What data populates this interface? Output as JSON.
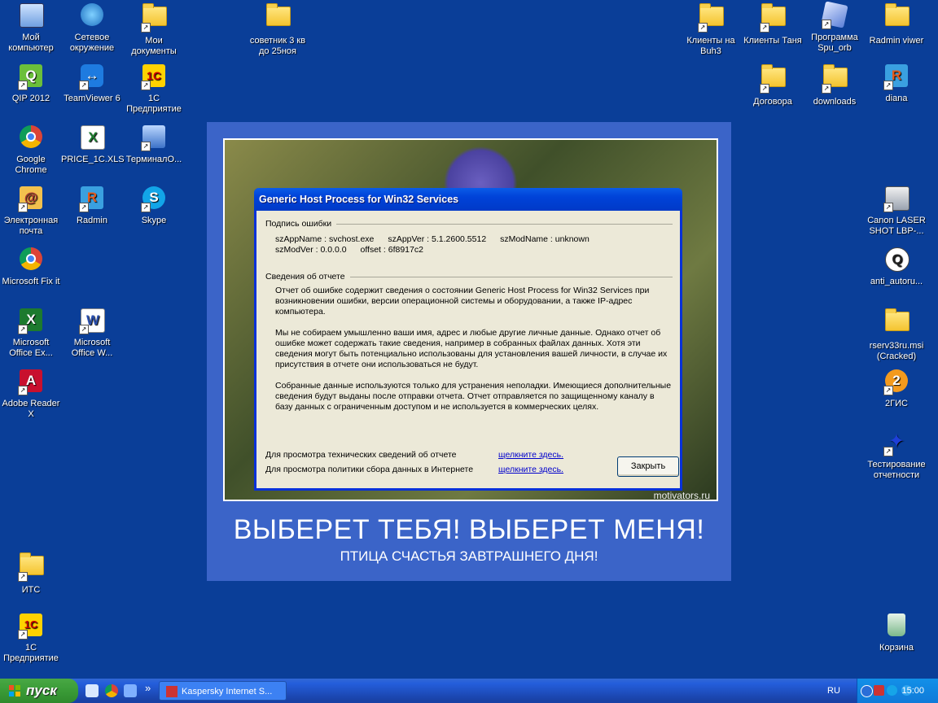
{
  "desktop_icons_left": [
    {
      "label": "Мой компьютер",
      "icon": "my-computer-icon"
    },
    {
      "label": "Сетевое окружение",
      "icon": "network-places-icon"
    },
    {
      "label": "Мои документы",
      "icon": "my-documents-icon"
    },
    {
      "label": "QIP 2012",
      "icon": "qip-icon"
    },
    {
      "label": "TeamViewer 6",
      "icon": "teamviewer-icon"
    },
    {
      "label": "1С Предприятие",
      "icon": "1c-icon"
    },
    {
      "label": "Google Chrome",
      "icon": "chrome-icon"
    },
    {
      "label": "PRICE_1C.XLS",
      "icon": "excel-file-icon"
    },
    {
      "label": "ТерминалО...",
      "icon": "terminal-icon"
    },
    {
      "label": "Электронная почта",
      "icon": "email-icon"
    },
    {
      "label": "Radmin",
      "icon": "radmin-icon"
    },
    {
      "label": "Skype",
      "icon": "skype-icon"
    },
    {
      "label": "Microsoft Fix it",
      "icon": "chrome-icon"
    },
    {
      "label": "Microsoft Office Ex...",
      "icon": "excel-icon"
    },
    {
      "label": "Microsoft Office W...",
      "icon": "word-icon"
    },
    {
      "label": "Adobe Reader X",
      "icon": "adobe-reader-icon"
    },
    {
      "label": "ИТС",
      "icon": "folder-icon"
    },
    {
      "label": "1С Предприятие",
      "icon": "1c-v8-icon"
    },
    {
      "label": "советник 3 кв до 25ноя",
      "icon": "folder-icon"
    }
  ],
  "desktop_icons_right": [
    {
      "label": "Клиенты на Buh3",
      "icon": "folder-icon"
    },
    {
      "label": "Клиенты Таня",
      "icon": "folder-icon"
    },
    {
      "label": "Программа Spu_orb",
      "icon": "program-icon"
    },
    {
      "label": "Radmin viwer",
      "icon": "folder-icon"
    },
    {
      "label": "Договора",
      "icon": "folder-icon"
    },
    {
      "label": "downloads",
      "icon": "folder-icon"
    },
    {
      "label": "diana",
      "icon": "radmin-icon"
    },
    {
      "label": "Canon LASER SHOT LBP-...",
      "icon": "printer-icon"
    },
    {
      "label": "anti_autoru...",
      "icon": "app-icon"
    },
    {
      "label": "rserv33ru.msi (Cracked)",
      "icon": "folder-icon"
    },
    {
      "label": "2ГИС",
      "icon": "2gis-icon"
    },
    {
      "label": "Тестирование отчетности",
      "icon": "butterfly-icon"
    },
    {
      "label": "Корзина",
      "icon": "recycle-bin-icon"
    }
  ],
  "poster": {
    "credit": "motivators.ru",
    "title": "ВЫБЕРЕТ ТЕБЯ! ВЫБЕРЕТ МЕНЯ!",
    "subtitle": "ПТИЦА СЧАСТЬЯ ЗАВТРАШНЕГО ДНЯ!"
  },
  "dialog": {
    "title": "Generic Host Process for Win32 Services",
    "section1": "Подпись ошибки",
    "sig_line1": [
      "szAppName : svchost.exe",
      "szAppVer : 5.1.2600.5512",
      "szModName : unknown"
    ],
    "sig_line2": [
      "szModVer : 0.0.0.0",
      "offset : 6f8917c2"
    ],
    "section2": "Сведения об отчете",
    "para1": "Отчет об ошибке содержит сведения о состоянии Generic Host Process for Win32 Services при возникновении ошибки, версии операционной системы и оборудовании, а также IP-адрес компьютера.",
    "para2": "Мы не собираем умышленно ваши имя, адрес и любые другие личные данные. Однако отчет об ошибке может содержать такие сведения, например в собранных файлах данных. Хотя эти сведения могут быть потенциально использованы для установления вашей личности, в случае их присутствия в отчете они использоваться не будут.",
    "para3": "Собранные данные используются только для устранения неполадки. Имеющиеся дополнительные сведения будут выданы после отправки отчета. Отчет отправляется по защищенному каналу в базу данных с ограниченным доступом и не используется в коммерческих целях.",
    "link_row1_text": "Для просмотра технических сведений об отчете",
    "link_row2_text": "Для просмотра политики сбора данных в Интернете",
    "link_label": "щелкните здесь.",
    "close_button": "Закрыть"
  },
  "taskbar": {
    "start_label": "пуск",
    "chevron": "»",
    "task_label": "Kaspersky Internet S...",
    "language": "RU",
    "time": "15:00"
  }
}
